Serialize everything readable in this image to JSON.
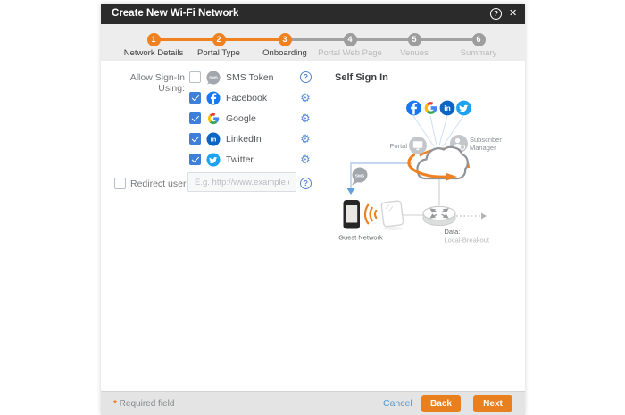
{
  "titlebar": {
    "title": "Create New Wi-Fi Network",
    "help_icon": "?",
    "close_icon": "✕"
  },
  "stepper": {
    "steps": [
      {
        "num": "1",
        "label": "Network Details",
        "state": "active"
      },
      {
        "num": "2",
        "label": "Portal Type",
        "state": "active"
      },
      {
        "num": "3",
        "label": "Onboarding",
        "state": "active-current"
      },
      {
        "num": "4",
        "label": "Portal Web Page",
        "state": "inactive"
      },
      {
        "num": "5",
        "label": "Venues",
        "state": "inactive"
      },
      {
        "num": "6",
        "label": "Summary",
        "state": "inactive"
      }
    ]
  },
  "signin": {
    "label": "Allow Sign-In Using:",
    "options": [
      {
        "label": "SMS Token",
        "icon": "sms-icon",
        "checked": false,
        "trailing": "help-icon"
      },
      {
        "label": "Facebook",
        "icon": "facebook-icon",
        "checked": true,
        "trailing": "gear-icon"
      },
      {
        "label": "Google",
        "icon": "google-icon",
        "checked": true,
        "trailing": "gear-icon"
      },
      {
        "label": "LinkedIn",
        "icon": "linkedin-icon",
        "checked": true,
        "trailing": "gear-icon"
      },
      {
        "label": "Twitter",
        "icon": "twitter-icon",
        "checked": true,
        "trailing": "gear-icon"
      }
    ]
  },
  "redirect": {
    "label": "Redirect users to:",
    "checked": false,
    "value": "",
    "placeholder": "E.g. http://www.example.com"
  },
  "diagram": {
    "title": "Self Sign In",
    "portal_label": "Portal",
    "subscriber_label_line1": "Subscriber",
    "subscriber_label_line2": "Manager",
    "sms_label": "SMS",
    "guest_label": "Guest Network",
    "data_label": "Data:",
    "breakout_label": "Local-Breakout"
  },
  "footer": {
    "required_star": "*",
    "required_text": " Required field",
    "cancel": "Cancel",
    "back": "Back",
    "next": "Next"
  },
  "icons": {
    "gear": "⚙",
    "help": "?"
  },
  "colors": {
    "orange_accent": "#EF8120",
    "checkbox_blue": "#3D7FD9",
    "link_blue": "#4F9BD8",
    "facebook_blue": "#1877F2",
    "linkedin_blue": "#0A66C2",
    "twitter_blue": "#1DA1F2",
    "titlebar_dark": "#2B2B2B"
  }
}
